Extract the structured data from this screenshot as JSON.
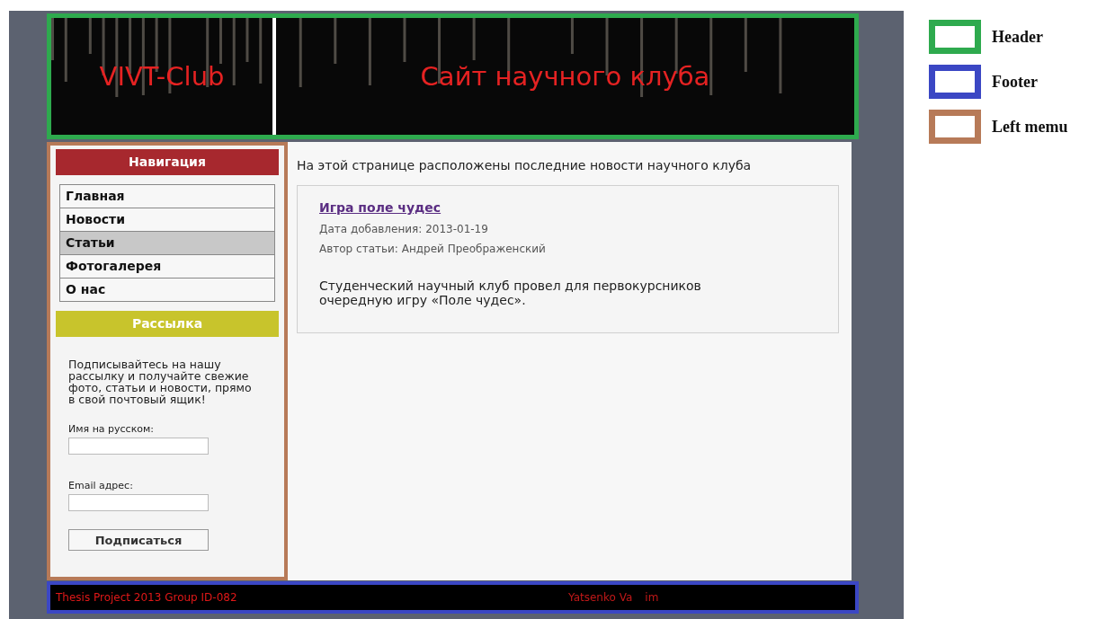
{
  "header": {
    "logo": "VIVT-Club",
    "title": "Сайт научного клуба"
  },
  "sidebar": {
    "nav_title": "Навигация",
    "items": [
      {
        "label": "Главная",
        "selected": false
      },
      {
        "label": "Новости",
        "selected": false
      },
      {
        "label": "Статьи",
        "selected": true
      },
      {
        "label": "Фотогалерея",
        "selected": false
      },
      {
        "label": "О нас",
        "selected": false
      }
    ],
    "newsletter": {
      "title": "Рассылка",
      "text": "Подписывайтесь на нашу рассылку и получайте свежие фото, статьи и новости, прямо в свой почтовый ящик!",
      "name_label": "Имя на русском:",
      "email_label": "Email адрес:",
      "button": "Подписаться"
    }
  },
  "content": {
    "intro": "На этой странице расположены последние новости научного клуба",
    "article": {
      "title": "Игра поле чудес",
      "date": "Дата добавления: 2013-01-19",
      "author": "Автор статьи: Андрей Преображенский",
      "text": "Студенческий научный клуб провел для первокурсников очередную игру «Поле чудес»."
    }
  },
  "footer": {
    "left": "Thesis Project 2013 Group ID-082",
    "right": [
      "Yatsenko Va",
      "im"
    ]
  },
  "legend": [
    {
      "label": "Header",
      "color": "#2eaa4e"
    },
    {
      "label": "Footer",
      "color": "#3b47c4"
    },
    {
      "label": "Left memu",
      "color": "#b77a58"
    }
  ]
}
